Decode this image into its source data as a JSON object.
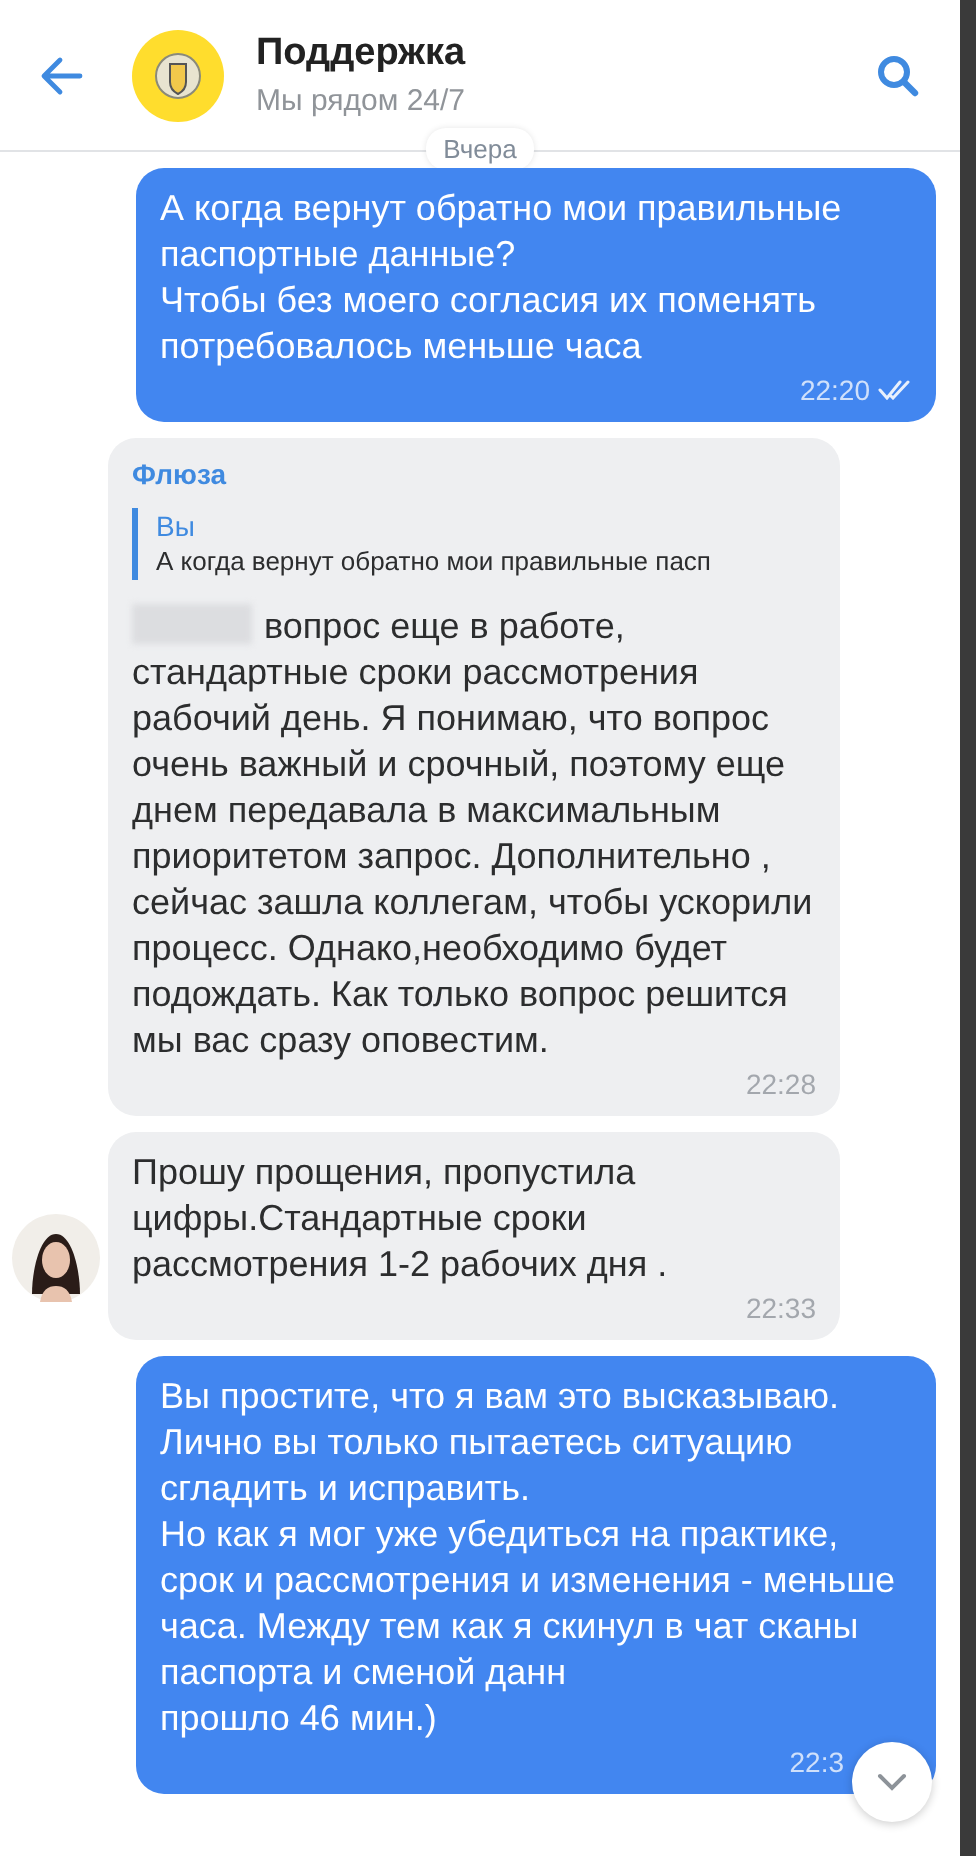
{
  "header": {
    "title": "Поддержка",
    "subtitle": "Мы рядом 24/7"
  },
  "date_label": "Вчера",
  "messages": [
    {
      "kind": "outgoing",
      "text": "А когда вернут обратно мои правильные паспортные данные?\nЧтобы без моего согласия их поменять потребовалось меньше часа",
      "time": "22:20",
      "read": true
    },
    {
      "kind": "incoming",
      "sender": "Флюза",
      "quote": {
        "author": "Вы",
        "text": "А когда вернут обратно мои правильные пасп"
      },
      "redacted": true,
      "text": "вопрос еще в работе, стандартные сроки рассмотрения рабочий день. Я понимаю, что вопрос очень важный и срочный, поэтому еще днем передавала в максимальным приоритетом запрос. Дополнительно , сейчас зашла коллегам, чтобы ускорили процесс. Однако,необходимо будет подождать. Как только вопрос решится мы вас сразу оповестим.",
      "time": "22:28",
      "show_avatar": false
    },
    {
      "kind": "incoming",
      "text": "Прошу прощения, пропустила цифры.Стандартные сроки рассмотрения 1-2 рабочих дня .",
      "time": "22:33",
      "show_avatar": true
    },
    {
      "kind": "outgoing",
      "text": "Вы простите, что я вам это высказываю.\nЛично вы только пытаетесь ситуацию сгладить и исправить.\nНо как я мог уже убедиться на практике, срок и рассмотрения и изменения - меньше часа. Между тем как я скинул в чат сканы паспорта и сменой данн\nпрошло 46 мин.)",
      "time": "22:3"
    }
  ]
}
